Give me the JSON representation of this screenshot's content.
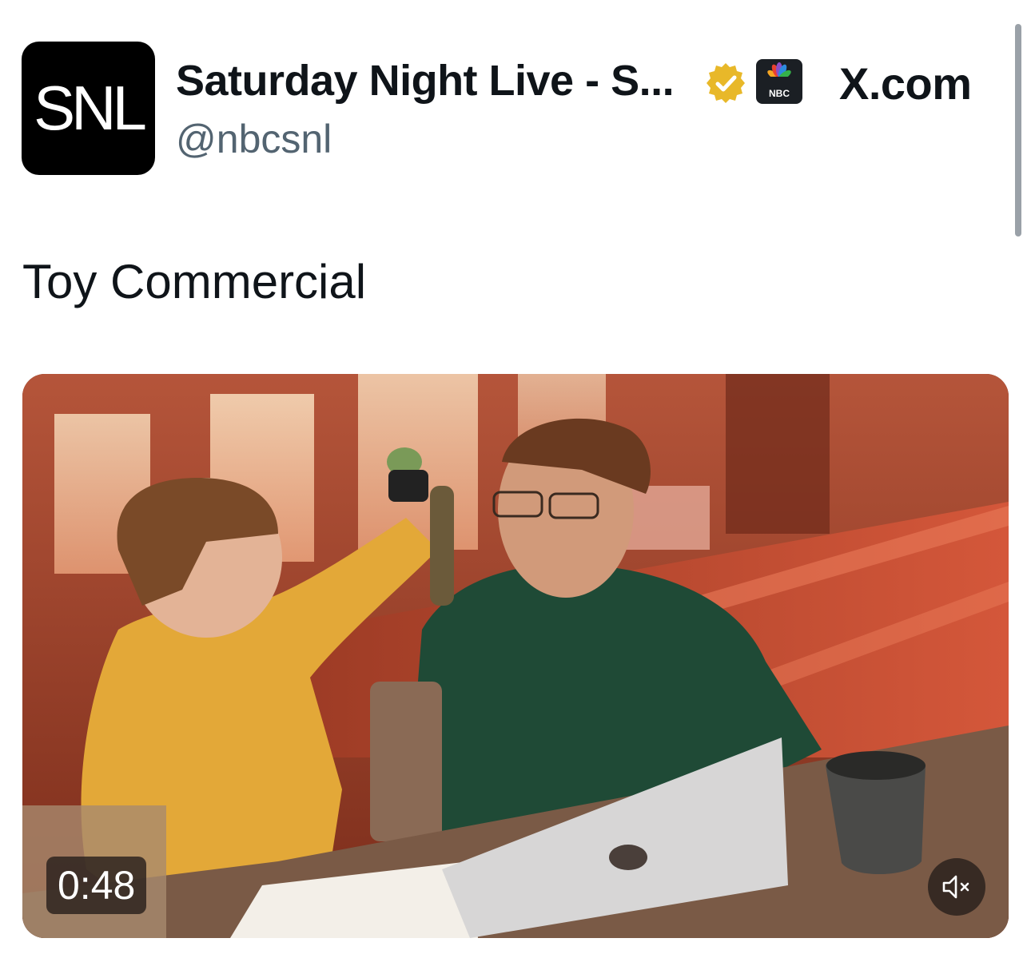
{
  "account": {
    "avatar_text": "SNL",
    "display_name": "Saturday Night Live - S...",
    "handle": "@nbcsnl",
    "verified_badge": "gold-verified-check",
    "affiliation_badge_text": "NBC"
  },
  "brand": {
    "site": "X.com"
  },
  "post": {
    "text": "Toy Commercial"
  },
  "video": {
    "duration": "0:48",
    "muted": true,
    "mute_icon": "volume-muted-icon"
  },
  "colors": {
    "text_primary": "#0f1419",
    "text_secondary": "#536471",
    "verified_gold": "#e8b829"
  }
}
